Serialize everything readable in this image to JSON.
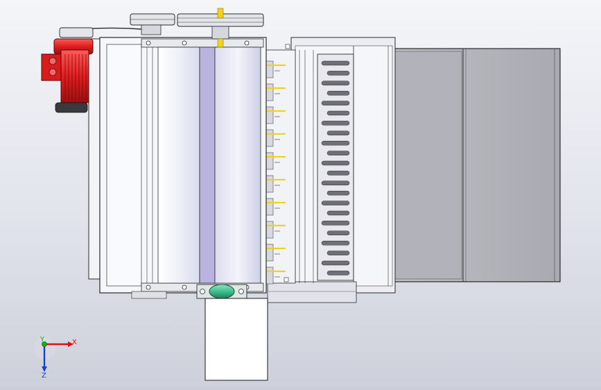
{
  "viewport": {
    "view": "top",
    "background": "#e6e8ef"
  },
  "model": {
    "colors": {
      "motor": "#e02020",
      "motor_dark": "#8a0f0f",
      "bearing_housing": "#3fbf8f",
      "drive_key": "#f2d21a",
      "roller_shade": "#b9b4dd",
      "edges": "#2a2a2a",
      "hopper": "#b7b8bf"
    },
    "rake_slot_count": 22,
    "tine_count": 10
  },
  "triad": {
    "x_label": "X",
    "y_label": "Y",
    "z_label": "Z",
    "x_color": "#d11",
    "y_color": "#19b019",
    "z_color": "#1a3fd6"
  }
}
